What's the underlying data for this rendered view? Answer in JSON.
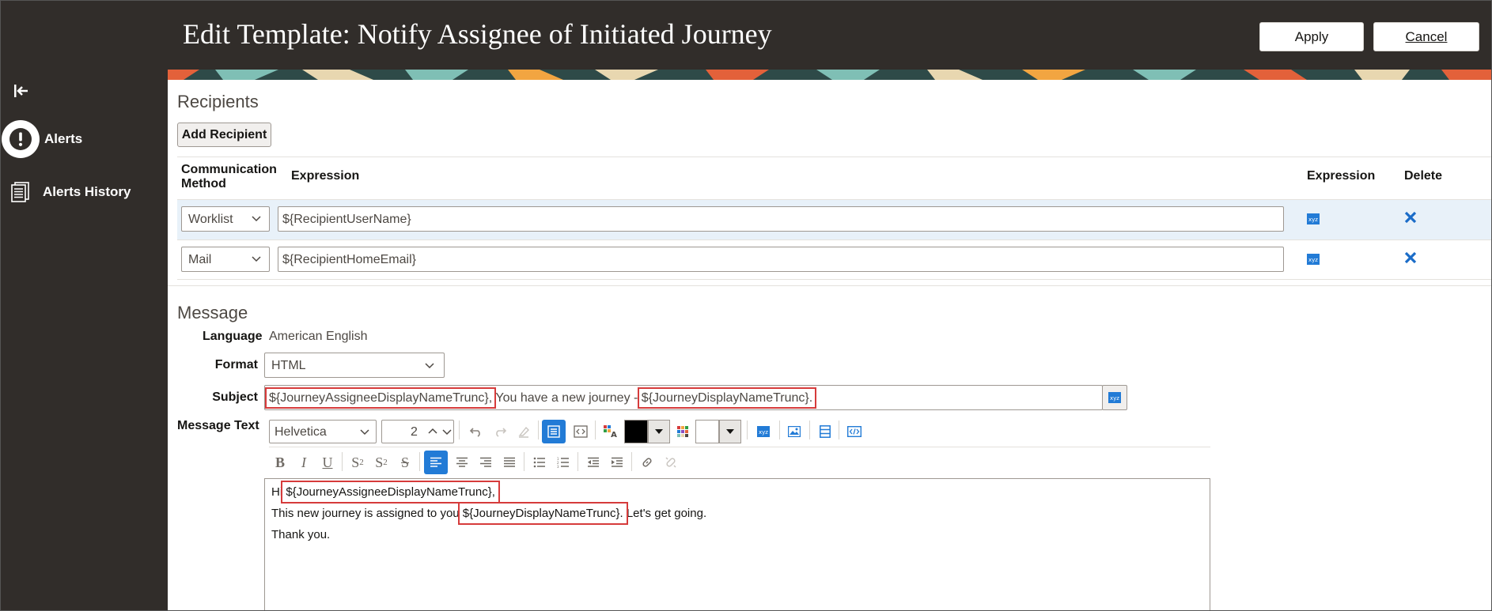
{
  "header": {
    "title": "Edit Template: Notify Assignee of Initiated Journey",
    "apply_label": "Apply",
    "cancel_label": "Cancel"
  },
  "sidebar": {
    "items": [
      {
        "label": "Alerts",
        "icon": "exclamation-icon"
      },
      {
        "label": "Alerts History",
        "icon": "document-list-icon"
      }
    ]
  },
  "recipients": {
    "title": "Recipients",
    "add_label": "Add Recipient",
    "columns": [
      "Communication Method",
      "Expression",
      "Expression",
      "Delete"
    ],
    "rows": [
      {
        "method": "Worklist",
        "expression": "${RecipientUserName}"
      },
      {
        "method": "Mail",
        "expression": "${RecipientHomeEmail}"
      }
    ]
  },
  "message": {
    "title": "Message",
    "language_label": "Language",
    "language_value": "American English",
    "format_label": "Format",
    "format_value": "HTML",
    "subject_label": "Subject",
    "subject_parts": [
      "${JourneyAssigneeDisplayNameTrunc},",
      " You have a new journey - ",
      "${JourneyDisplayNameTrunc}."
    ],
    "message_text_label": "Message Text"
  },
  "toolbar": {
    "font": "Helvetica",
    "size": "2",
    "text_color": "#000000",
    "bg_color": "#ffffff"
  },
  "editor": {
    "line1": [
      "Hi ",
      "${JourneyAssigneeDisplayNameTrunc},"
    ],
    "line2": [
      "This new journey is assigned to you ",
      "${JourneyDisplayNameTrunc}.",
      " Let's get going."
    ],
    "line3": "Thank you."
  },
  "colors": {
    "header_bg": "#312d2a",
    "accent": "#227bd6",
    "delete": "#1a6cc8",
    "highlight_box": "#d63b3b",
    "selected_row": "#e8f1f9"
  }
}
